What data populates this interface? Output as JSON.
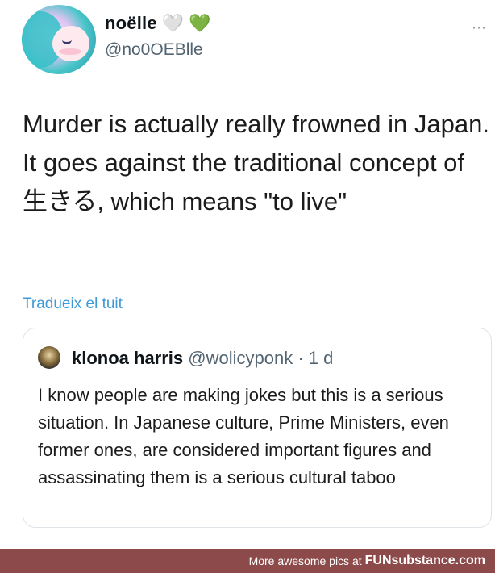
{
  "tweet": {
    "author_name": "noëlle",
    "hearts": [
      "🤍",
      "💚"
    ],
    "handle": "@no0OEBlle",
    "more_icon": "⋯",
    "text": "Murder is actually really frowned in Japan. It goes against the traditional concept of 生きる, which means \"to live\"",
    "translate_link": "Tradueix el tuit"
  },
  "quote": {
    "author_name": "klonoa harris",
    "meta": "@wolicyponk · 1 d",
    "text": "I know people are making jokes but this is a serious situation. In Japanese culture, Prime Ministers, even former ones, are considered important figures and assassinating them is a serious cultural taboo"
  },
  "footer": {
    "prefix": "More awesome pics at",
    "brand": "FUNsubstance.com"
  },
  "colors": {
    "link": "#3c9ad6",
    "footer_bg": "#8d4a4a"
  }
}
